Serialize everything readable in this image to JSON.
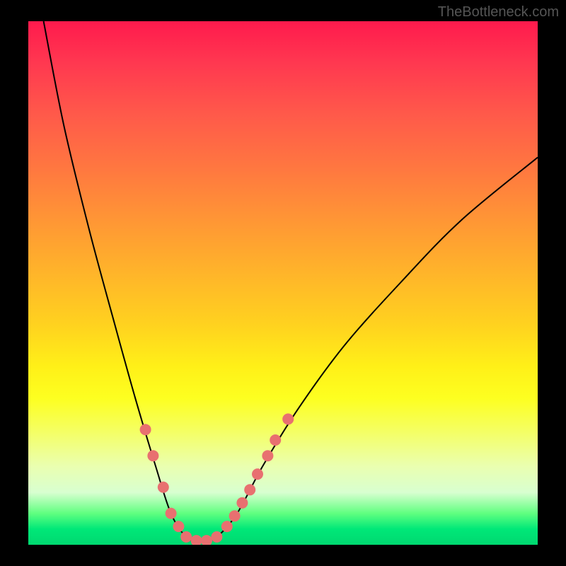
{
  "watermark": "TheBottleneck.com",
  "colors": {
    "background": "#000000",
    "curve": "#000000",
    "markers": "#e87070"
  },
  "chart_data": {
    "type": "line",
    "title": "",
    "xlabel": "",
    "ylabel": "",
    "xlim": [
      0,
      100
    ],
    "ylim": [
      0,
      100
    ],
    "series": [
      {
        "name": "bottleneck-curve",
        "description": "V-shaped bottleneck curve; left branch steep, right branch shallower",
        "points": [
          {
            "x": 3,
            "y": 100
          },
          {
            "x": 7,
            "y": 80
          },
          {
            "x": 12,
            "y": 60
          },
          {
            "x": 17,
            "y": 42
          },
          {
            "x": 21,
            "y": 28
          },
          {
            "x": 25,
            "y": 15
          },
          {
            "x": 28,
            "y": 6
          },
          {
            "x": 31,
            "y": 1.5
          },
          {
            "x": 34,
            "y": 0.5
          },
          {
            "x": 37,
            "y": 1.5
          },
          {
            "x": 41,
            "y": 6
          },
          {
            "x": 46,
            "y": 15
          },
          {
            "x": 53,
            "y": 26
          },
          {
            "x": 62,
            "y": 38
          },
          {
            "x": 73,
            "y": 50
          },
          {
            "x": 85,
            "y": 62
          },
          {
            "x": 100,
            "y": 74
          }
        ]
      }
    ],
    "markers": {
      "name": "highlighted-segment",
      "left_branch": [
        {
          "x": 23,
          "y": 22
        },
        {
          "x": 24.5,
          "y": 17
        },
        {
          "x": 26.5,
          "y": 11
        },
        {
          "x": 28,
          "y": 6
        },
        {
          "x": 29.5,
          "y": 3.5
        }
      ],
      "bottom": [
        {
          "x": 31,
          "y": 1.5
        },
        {
          "x": 33,
          "y": 0.8
        },
        {
          "x": 35,
          "y": 0.8
        },
        {
          "x": 37,
          "y": 1.5
        }
      ],
      "right_branch": [
        {
          "x": 39,
          "y": 3.5
        },
        {
          "x": 40.5,
          "y": 5.5
        },
        {
          "x": 42,
          "y": 8
        },
        {
          "x": 43.5,
          "y": 10.5
        },
        {
          "x": 45,
          "y": 13.5
        },
        {
          "x": 47,
          "y": 17
        },
        {
          "x": 48.5,
          "y": 20
        },
        {
          "x": 51,
          "y": 24
        }
      ]
    }
  }
}
